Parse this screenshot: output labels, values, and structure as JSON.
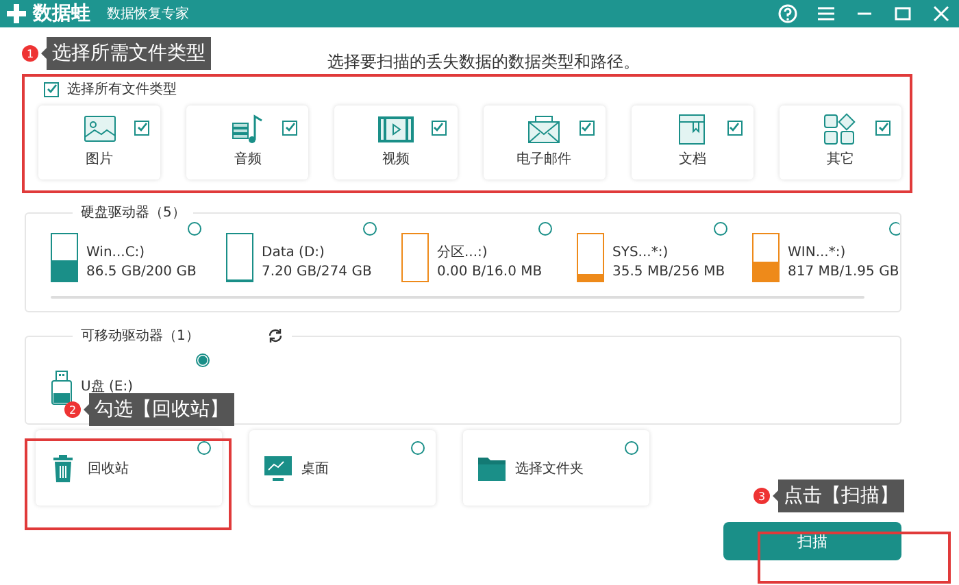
{
  "window": {
    "app_name": "数据蛙",
    "subtitle": "数据恢复专家"
  },
  "instruction": "选择要扫描的丢失数据的数据类型和路径。",
  "select_all": {
    "label": "选择所有文件类型",
    "checked": true
  },
  "file_types": [
    {
      "label": "图片",
      "kind": "image",
      "checked": true
    },
    {
      "label": "音频",
      "kind": "audio",
      "checked": true
    },
    {
      "label": "视频",
      "kind": "video",
      "checked": true
    },
    {
      "label": "电子邮件",
      "kind": "email",
      "checked": true
    },
    {
      "label": "文档",
      "kind": "document",
      "checked": true
    },
    {
      "label": "其它",
      "kind": "other",
      "checked": true
    }
  ],
  "hard_drives": {
    "title": "硬盘驱动器（5）",
    "drives": [
      {
        "name": "Win...C:)",
        "size": "86.5 GB/200 GB",
        "level": 0.45,
        "color": "#1a8f88",
        "selected": false
      },
      {
        "name": "Data (D:)",
        "size": "7.20 GB/274 GB",
        "level": 0.03,
        "color": "#1a8f88",
        "selected": false
      },
      {
        "name": "分区...:)",
        "size": "0.00  B/16.0 MB",
        "level": 0,
        "color": "#ee8a1a",
        "selected": false
      },
      {
        "name": "SYS...*:)",
        "size": "35.5 MB/256 MB",
        "level": 0.14,
        "color": "#ee8a1a",
        "selected": false
      },
      {
        "name": "WIN...*:)",
        "size": "817 MB/1.95 GB",
        "level": 0.42,
        "color": "#ee8a1a",
        "selected": false
      }
    ]
  },
  "removable": {
    "title": "可移动驱动器（1）",
    "drives": [
      {
        "name": "U盘 (E:)",
        "selected": true
      }
    ]
  },
  "locations": [
    {
      "label": "回收站",
      "kind": "recycle",
      "selected": false
    },
    {
      "label": "桌面",
      "kind": "desktop",
      "selected": false
    },
    {
      "label": "选择文件夹",
      "kind": "folder",
      "selected": false
    }
  ],
  "scan_button": "扫描",
  "annotations": [
    {
      "number": "1",
      "text": "选择所需文件类型"
    },
    {
      "number": "2",
      "text": "勾选【回收站】"
    },
    {
      "number": "3",
      "text": "点击【扫描】"
    }
  ]
}
